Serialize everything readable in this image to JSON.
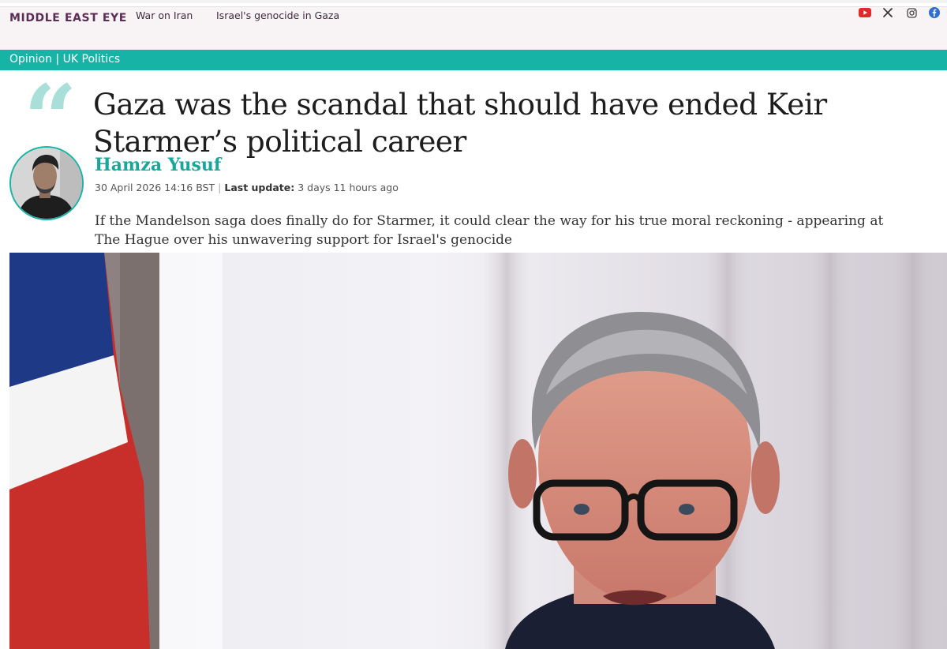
{
  "header": {
    "logo": "MIDDLE EAST EYE",
    "nav": [
      "War on Iran",
      "Israel's genocide in Gaza"
    ],
    "social_icons": [
      "youtube-icon",
      "x-icon",
      "instagram-icon",
      "facebook-icon"
    ]
  },
  "section": {
    "category": "Opinion",
    "separator": "|",
    "subcategory": "UK Politics"
  },
  "article": {
    "title": "Gaza was the scandal that should have ended Keir Starmer’s political career",
    "author": "Hamza Yusuf",
    "published": "30 April 2026 14:16 BST",
    "separator": "|",
    "last_update_label": "Last update:",
    "last_update_value": "3 days 11 hours ago",
    "standfirst": "If the Mandelson saga does finally do for Starmer, it could clear the way for his true moral reckoning - appearing at The Hague over his unwavering support for Israel's genocide"
  },
  "colors": {
    "brand": "#5b2d54",
    "accent": "#17b3a6",
    "quote": "#a9dfd9",
    "topbar_bg": "#f8f4f6"
  }
}
